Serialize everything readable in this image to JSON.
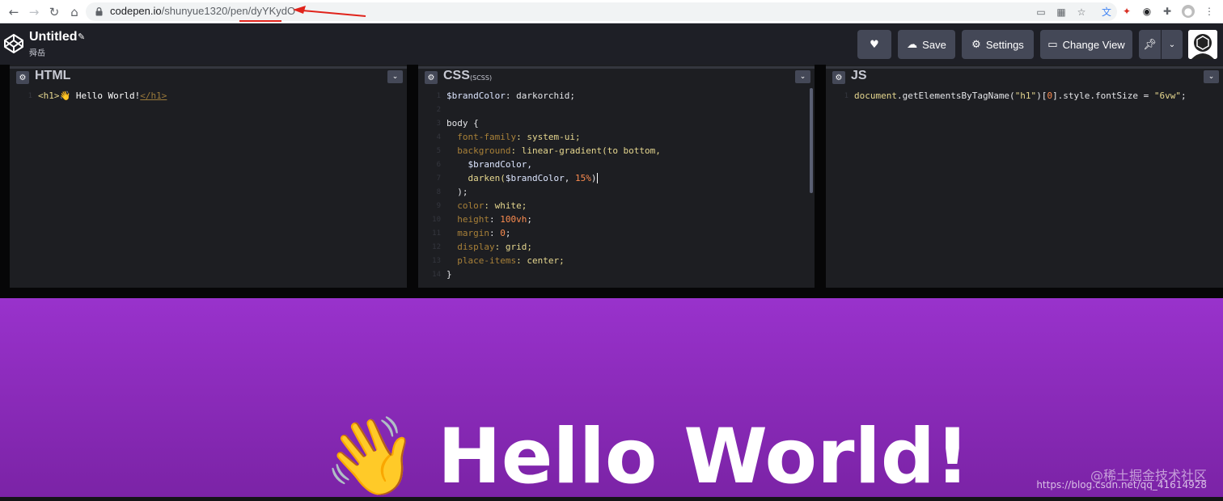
{
  "browser": {
    "url_host": "codepen.io",
    "url_path_prefix": "/shunyue1320/pen/",
    "url_path_id": "dyYKydO",
    "back_icon": "arrow-left",
    "forward_icon": "arrow-right",
    "reload_icon": "reload",
    "home_icon": "home"
  },
  "header": {
    "title": "Untitled",
    "author": "舜岳",
    "buttons": {
      "like": "",
      "save": "Save",
      "settings": "Settings",
      "change_view": "Change View"
    }
  },
  "editors": {
    "html": {
      "label": "HTML",
      "lines": [
        {
          "n": "1"
        }
      ]
    },
    "css": {
      "label": "CSS",
      "sublabel": "(SCSS)",
      "line_numbers": [
        "1",
        "2",
        "3",
        "4",
        "5",
        "6",
        "7",
        "8",
        "9",
        "10",
        "11",
        "12",
        "13",
        "14"
      ]
    },
    "js": {
      "label": "JS",
      "line_numbers": [
        "1"
      ]
    }
  },
  "code": {
    "html_l1_open": "<h1>",
    "html_l1_emoji": "👋",
    "html_l1_text": " Hello World!",
    "html_l1_close": "</h1>",
    "css_l1_var": "$brandColor",
    "css_l1_rest": ": darkorchid;",
    "css_l3": "body {",
    "css_l4_prop": "  font-family",
    "css_l4_val": ": system-ui;",
    "css_l5_prop": "  background",
    "css_l5_val": ": linear-gradient(to bottom,",
    "css_l6": "    $brandColor,",
    "css_l7_fn": "    darken(",
    "css_l7_var": "$brandColor",
    "css_l7_sep": ", ",
    "css_l7_num": "15%",
    "css_l7_end": ")",
    "css_l8": "  );",
    "css_l9_prop": "  color",
    "css_l9_val": ": white;",
    "css_l10_prop": "  height",
    "css_l10_sep": ": ",
    "css_l10_num": "100vh",
    "css_l10_end": ";",
    "css_l11_prop": "  margin",
    "css_l11_sep": ": ",
    "css_l11_num": "0",
    "css_l11_end": ";",
    "css_l12_prop": "  display",
    "css_l12_val": ": grid;",
    "css_l13_prop": "  place-items",
    "css_l13_val": ": center;",
    "css_l14": "}",
    "js_l1_a": "document",
    "js_l1_b": ".getElementsByTagName(",
    "js_l1_c": "\"h1\"",
    "js_l1_d": ")[",
    "js_l1_e": "0",
    "js_l1_f": "].style.fontSize = ",
    "js_l1_g": "\"6vw\"",
    "js_l1_h": ";"
  },
  "preview": {
    "emoji": "👋",
    "heading": "Hello World!",
    "watermark_cn": "@稀土掘金技术社区",
    "watermark_url": "https://blog.csdn.net/qq_41614928"
  },
  "colors": {
    "annotation": "#e0231b",
    "brand": "#9932cc"
  }
}
